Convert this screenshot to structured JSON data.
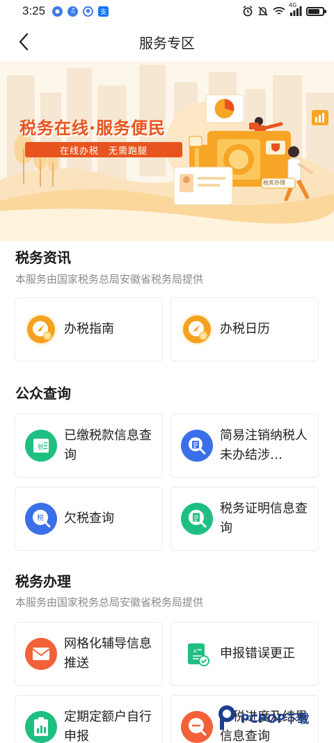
{
  "status_bar": {
    "time": "3:25",
    "network": "4G",
    "app_icons": [
      "app-circle-icon",
      "music-icon",
      "shield-app-icon",
      "alipay-icon"
    ],
    "right_icons": [
      "alarm-icon",
      "mute-icon",
      "wifi-icon",
      "signal-icon",
      "battery-icon"
    ],
    "battery_level": 0.8
  },
  "nav": {
    "title": "服务专区",
    "back_icon": "chevron-left-icon"
  },
  "banner": {
    "headline": "税务在线·服务便民",
    "ribbon": "在线办税　无需跑腿",
    "badge": "税务办理",
    "colors": {
      "primary": "#f5a623",
      "headline": "#e8541f",
      "ribbon": "#e8541f"
    }
  },
  "sections": [
    {
      "title": "税务资讯",
      "subtitle": "本服务由国家税务总局安徽省税务局提供",
      "items": [
        {
          "label": "办税指南",
          "icon": "tax-guide-icon",
          "color": "#f5a11f"
        },
        {
          "label": "办税日历",
          "icon": "tax-calendar-icon",
          "color": "#f5a11f"
        }
      ]
    },
    {
      "title": "公众查询",
      "subtitle": "",
      "items": [
        {
          "label": "已缴税款信息查询",
          "icon": "paid-tax-icon",
          "color": "#1fbf82"
        },
        {
          "label": "简易注销纳税人未办结涉…",
          "icon": "deregistration-search-icon",
          "color": "#3b6fe8"
        },
        {
          "label": "欠税查询",
          "icon": "tax-arrears-search-icon",
          "color": "#3b6fe8"
        },
        {
          "label": "税务证明信息查询",
          "icon": "tax-certificate-icon",
          "color": "#1fbf82"
        }
      ]
    },
    {
      "title": "税务办理",
      "subtitle": "本服务由国家税务总局安徽省税务局提供",
      "items": [
        {
          "label": "网格化辅导信息推送",
          "icon": "grid-message-icon",
          "color": "#f2613a"
        },
        {
          "label": "申报错误更正",
          "icon": "declaration-correct-icon",
          "color": "#1fbf82"
        },
        {
          "label": "定期定额户自行申报",
          "icon": "fixed-quota-report-icon",
          "color": "#1fbf82"
        },
        {
          "label": "办税进度及结果信息查询",
          "icon": "progress-search-icon",
          "color": "#f2613a"
        }
      ]
    }
  ],
  "watermark": {
    "text": "PCPOP下载"
  }
}
